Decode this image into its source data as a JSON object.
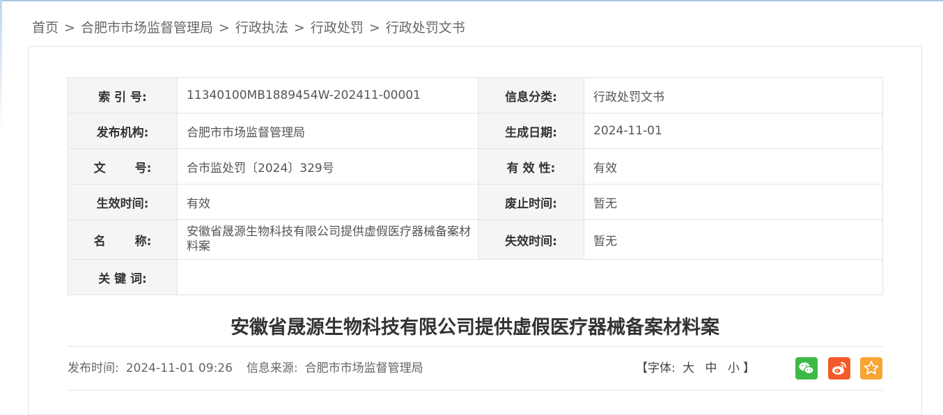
{
  "breadcrumb": {
    "items": [
      "首页",
      "合肥市市场监督管理局",
      "行政执法",
      "行政处罚",
      "行政处罚文书"
    ],
    "separator": ">"
  },
  "meta": {
    "index_no_label": "索 引 号:",
    "index_no": "11340100MB1889454W-202411-00001",
    "category_label": "信息分类:",
    "category": "行政处罚文书",
    "publisher_label": "发布机构:",
    "publisher": "合肥市市场监督管理局",
    "gen_date_label": "生成日期:",
    "gen_date": "2024-11-01",
    "doc_no_label_a": "文",
    "doc_no_label_b": "号:",
    "doc_no": "合市监处罚〔2024〕329号",
    "validity_label": "有 效 性:",
    "validity": "有效",
    "effective_label": "生效时间:",
    "effective": "有效",
    "repeal_label": "废止时间:",
    "repeal": "暂无",
    "name_label_a": "名",
    "name_label_b": "称:",
    "name": "安徽省晟源生物科技有限公司提供虚假医疗器械备案材料案",
    "expire_label": "失效时间:",
    "expire": "暂无",
    "keywords_label": "关 键 词:",
    "keywords": ""
  },
  "article": {
    "title": "安徽省晟源生物科技有限公司提供虚假医疗器械备案材料案",
    "publish_time_label": "发布时间:",
    "publish_time": "2024-11-01 09:26",
    "source_label": "信息来源:",
    "source": "合肥市市场监督管理局"
  },
  "font_size": {
    "open": "【字体:",
    "large": "大",
    "medium": "中",
    "small": "小",
    "close": "】"
  },
  "share": {
    "icons": [
      "wechat-icon",
      "weibo-icon",
      "favorite-icon"
    ],
    "colors": {
      "wechat": "#3dba45",
      "weibo": "#f25a29",
      "favorite": "#f8a531"
    }
  }
}
